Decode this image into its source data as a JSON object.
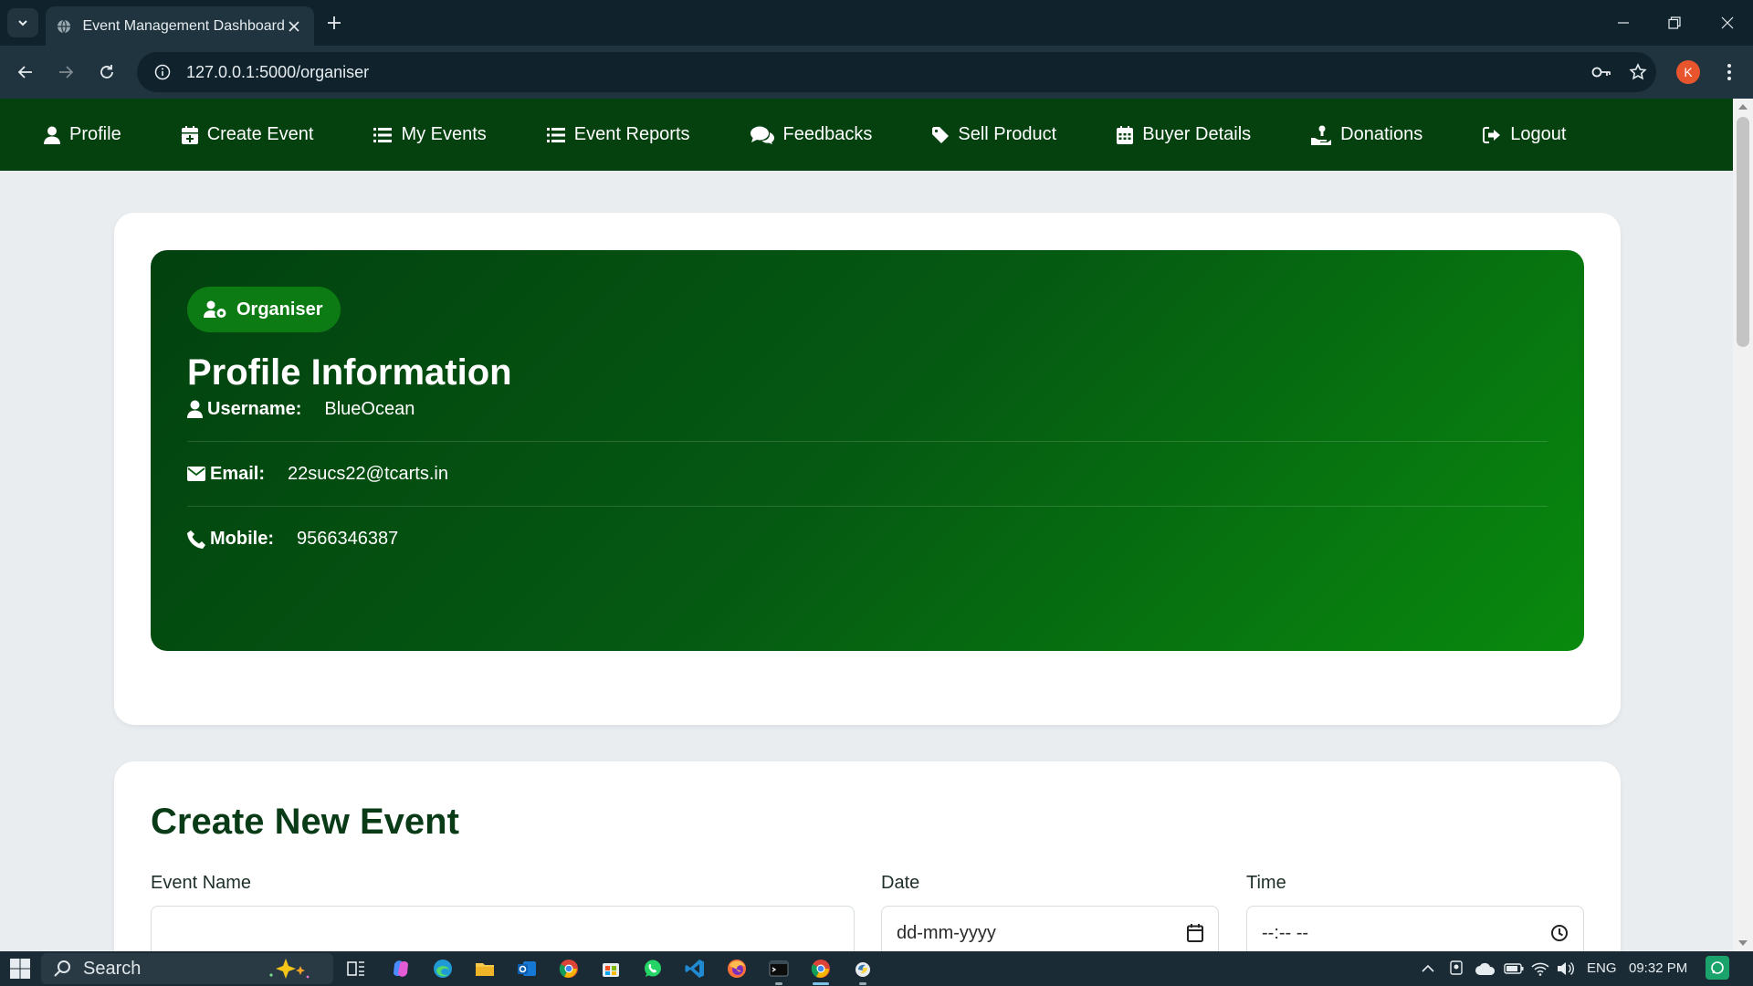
{
  "browser": {
    "tab_title": "Event Management Dashboard",
    "url": "127.0.0.1:5000/organiser",
    "profile_initial": "K"
  },
  "nav": {
    "items": [
      {
        "label": "Profile",
        "icon": "user-icon"
      },
      {
        "label": "Create Event",
        "icon": "calendar-plus-icon"
      },
      {
        "label": "My Events",
        "icon": "list-icon"
      },
      {
        "label": "Event Reports",
        "icon": "list-icon"
      },
      {
        "label": "Feedbacks",
        "icon": "comments-icon"
      },
      {
        "label": "Sell Product",
        "icon": "tag-icon"
      },
      {
        "label": "Buyer Details",
        "icon": "calendar-grid-icon"
      },
      {
        "label": "Donations",
        "icon": "hand-holding-icon"
      },
      {
        "label": "Logout",
        "icon": "logout-icon"
      }
    ]
  },
  "profile": {
    "badge": "Organiser",
    "title": "Profile Information",
    "username_label": "Username:",
    "username": "BlueOcean",
    "email_label": "Email:",
    "email": "22sucs22@tcarts.in",
    "mobile_label": "Mobile:",
    "mobile": "9566346387"
  },
  "create_event": {
    "title": "Create New Event",
    "event_name_label": "Event Name",
    "event_name_value": "",
    "date_label": "Date",
    "date_placeholder": "dd-mm-yyyy",
    "time_label": "Time",
    "time_placeholder": "--:-- --"
  },
  "taskbar": {
    "search_placeholder": "Search",
    "language": "ENG",
    "time": "09:32 PM"
  },
  "colors": {
    "nav_bg": "#04410f",
    "panel_gradient_start": "#02410f",
    "panel_gradient_end": "#098a0e",
    "badge_bg": "#0d7b14",
    "heading_text": "#0a3b17"
  }
}
